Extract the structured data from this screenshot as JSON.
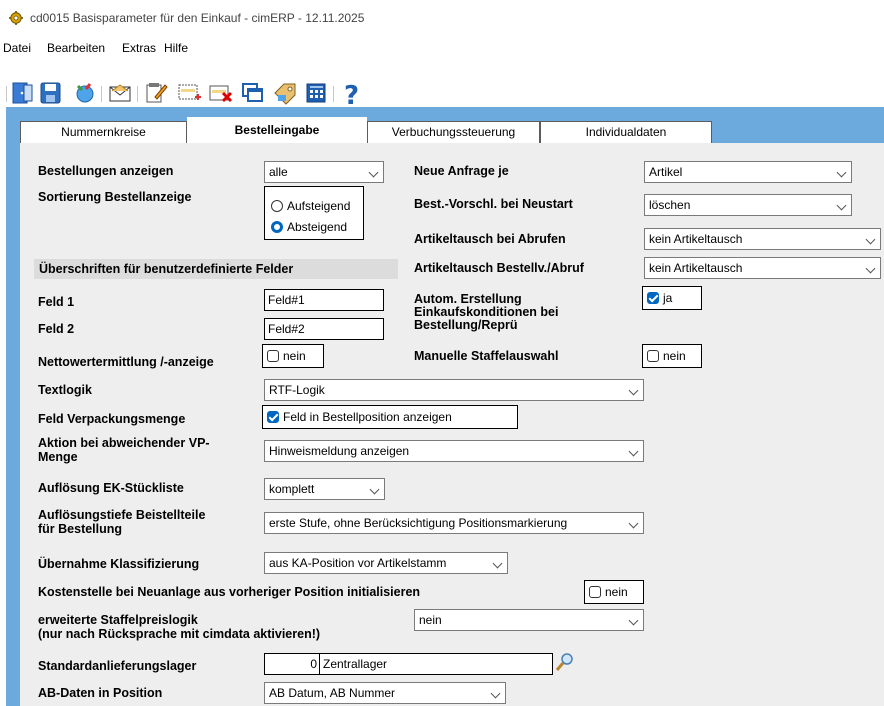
{
  "window": {
    "title": "cd0015 Basisparameter für den Einkauf - cimERP - 12.11.2025"
  },
  "menu": [
    "Datei",
    "Bearbeiten",
    "Extras",
    "Hilfe"
  ],
  "tabs": [
    "Nummernkreise",
    "Bestelleingabe",
    "Verbuchungssteuerung",
    "Individualdaten"
  ],
  "form": {
    "bestellungen_anzeigen": {
      "label": "Bestellungen anzeigen",
      "value": "alle"
    },
    "sortierung": {
      "label": "Sortierung Bestellanzeige",
      "options": [
        "Aufsteigend",
        "Absteigend"
      ],
      "selected": "Absteigend"
    },
    "ueberschriften": "Überschriften für benutzerdefinierte Felder",
    "feld1": {
      "label": "Feld 1",
      "value": "Feld#1"
    },
    "feld2": {
      "label": "Feld 2",
      "value": "Feld#2"
    },
    "nettowert": {
      "label": "Nettowertermittlung /-anzeige",
      "checked": false,
      "text": "nein"
    },
    "textlogik": {
      "label": "Textlogik",
      "value": "RTF-Logik"
    },
    "verpackung": {
      "label": "Feld Verpackungsmenge",
      "checked": true,
      "text": "Feld in Bestellposition anzeigen"
    },
    "aktion_vp": {
      "label1": "Aktion bei abweichender VP-",
      "label2": "Menge",
      "value": "Hinweismeldung anzeigen"
    },
    "aufloesung_ek": {
      "label": "Auflösung EK-Stückliste",
      "value": "komplett"
    },
    "aufloesungstiefe": {
      "label1": "Auflösungstiefe Beistellteile",
      "label2": "für Bestellung",
      "value": "erste Stufe, ohne Berücksichtigung Positionsmarkierung"
    },
    "klassifizierung": {
      "label": "Übernahme Klassifizierung",
      "value": "aus KA-Position vor Artikelstamm"
    },
    "kostenstelle": {
      "label": "Kostenstelle bei Neuanlage aus vorheriger Position initialisieren",
      "checked": false,
      "text": "nein"
    },
    "staffelpreis": {
      "label1": "erweiterte Staffelpreislogik",
      "label2": "(nur nach Rücksprache mit cimdata aktivieren!)",
      "value": "nein"
    },
    "lager": {
      "label": "Standardanlieferungslager",
      "number": "0",
      "name": "Zentrallager"
    },
    "ab_daten": {
      "label": "AB-Daten in Position",
      "value": "AB Datum, AB Nummer"
    },
    "neue_anfrage": {
      "label": "Neue Anfrage je",
      "value": "Artikel"
    },
    "best_vorschl": {
      "label": "Best.-Vorschl. bei Neustart",
      "value": "löschen"
    },
    "artikeltausch_abrufen": {
      "label": "Artikeltausch bei Abrufen",
      "value": "kein Artikeltausch"
    },
    "artikeltausch_bestellv": {
      "label": "Artikeltausch Bestellv./Abruf",
      "value": "kein Artikeltausch"
    },
    "autom_erstellung": {
      "label1": "Autom. Erstellung",
      "label2": "Einkaufskonditionen bei",
      "label3": "Bestellung/Reprü",
      "checked": true,
      "text": "ja"
    },
    "manuelle_staffel": {
      "label": "Manuelle Staffelauswahl",
      "checked": false,
      "text": "nein"
    }
  },
  "colors": {
    "tab_panel": "#6ca9dd",
    "content_bg": "#eeeeee",
    "accent": "#0067c0"
  }
}
